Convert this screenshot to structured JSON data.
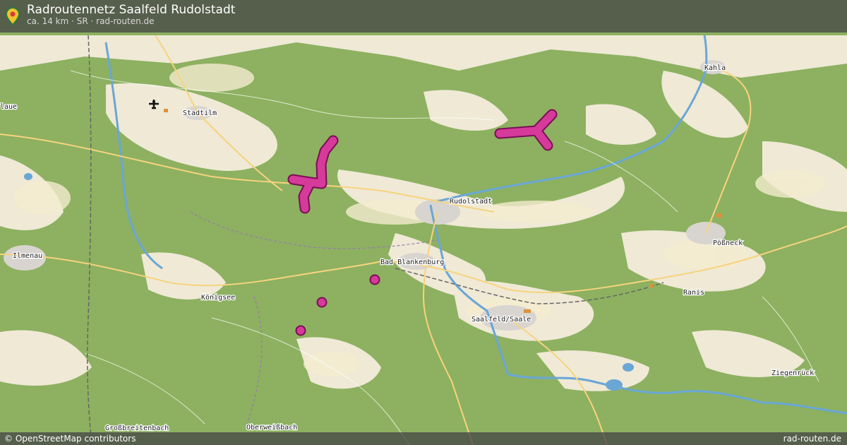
{
  "header": {
    "title": "Radroutennetz Saalfeld Rudolstadt",
    "subtitle": "ca. 14 km · SR · rad-routen.de"
  },
  "footer": {
    "attribution": "© OpenStreetMap contributors",
    "brand": "rad-routen.de"
  },
  "map": {
    "places": {
      "kahla": "Kahla",
      "laue": "laue",
      "stadtilm": "Stadtilm",
      "rudolstadt": "Rudolstadt",
      "poessneck": "Pößneck",
      "ilmenau": "Ilmenau",
      "bad_blankenburg": "Bad Blankenburg",
      "ranis": "Ranis",
      "koenigsee": "Königsee",
      "saalfeld": "Saalfeld/Saale",
      "ziegenrueck": "Ziegenrück",
      "grossbreitenbach": "Großbreitenbach",
      "oberweissbach": "Oberweißbach"
    },
    "colors": {
      "forest": "#8db160",
      "meadow": "#f2efe9",
      "field": "#eef0d5",
      "route": "#d63a9a",
      "route_outline": "#7a0f55",
      "water": "#6aa6d6"
    },
    "icons": {
      "airport": "airplane-icon",
      "pin": "map-pin-icon"
    }
  }
}
